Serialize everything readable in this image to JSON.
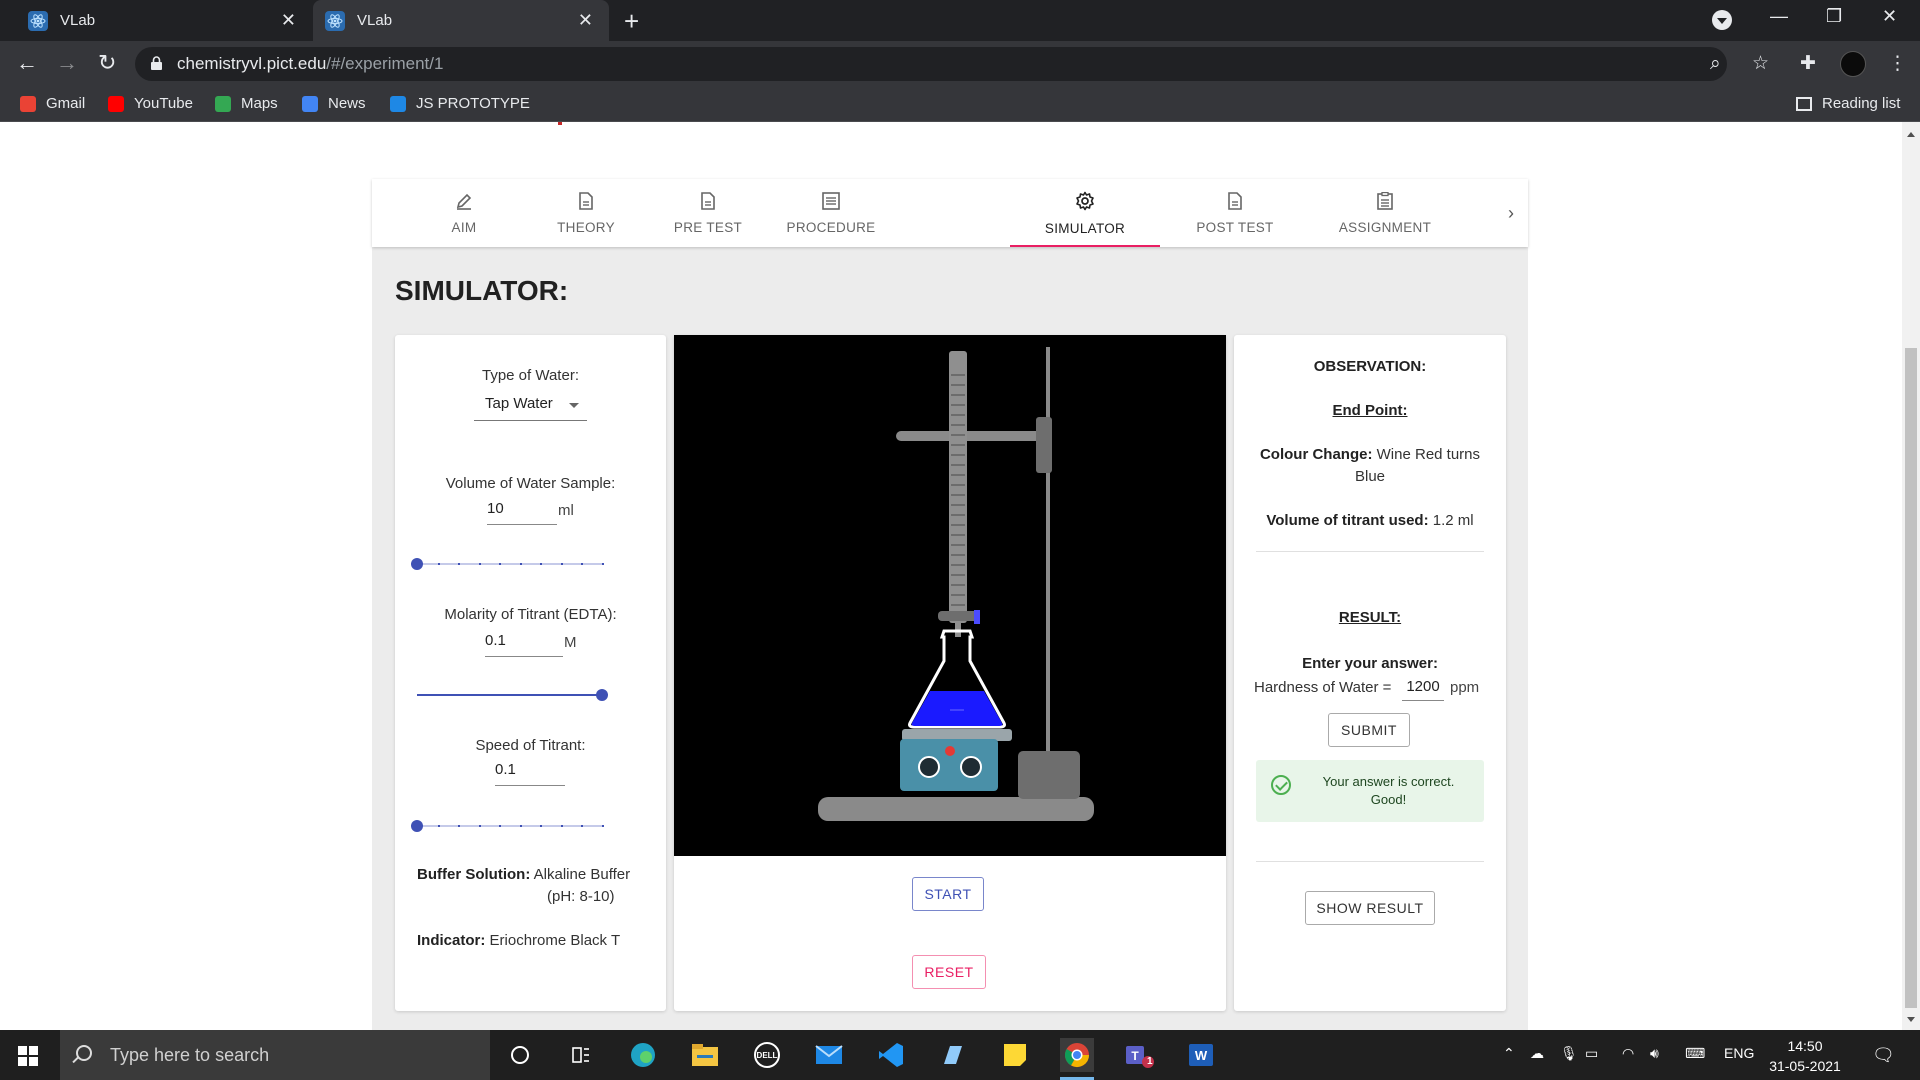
{
  "browser": {
    "tabs": [
      {
        "title": "VLab",
        "active": false
      },
      {
        "title": "VLab",
        "active": true
      }
    ],
    "url_domain": "chemistryvl.pict.edu",
    "url_path": "/#/experiment/1",
    "bookmarks": [
      {
        "label": "Gmail",
        "icon": "gmail-icon",
        "color": "#ea4335"
      },
      {
        "label": "YouTube",
        "icon": "youtube-icon",
        "color": "#ff0000"
      },
      {
        "label": "Maps",
        "icon": "maps-icon",
        "color": "#34a853"
      },
      {
        "label": "News",
        "icon": "news-icon",
        "color": "#4285f4"
      },
      {
        "label": "JS PROTOTYPE",
        "icon": "js-prototype-icon",
        "color": "#1e88e5"
      }
    ],
    "reading_list": "Reading list"
  },
  "nav_tabs": [
    {
      "label": "AIM",
      "icon": "pencil-icon"
    },
    {
      "label": "THEORY",
      "icon": "document-icon"
    },
    {
      "label": "PRE TEST",
      "icon": "document-icon"
    },
    {
      "label": "PROCEDURE",
      "icon": "list-icon"
    },
    {
      "label": "SIMULATOR",
      "icon": "gear-icon",
      "active": true
    },
    {
      "label": "POST TEST",
      "icon": "document-icon"
    },
    {
      "label": "ASSIGNMENT",
      "icon": "clipboard-icon"
    }
  ],
  "page_title": "SIMULATOR:",
  "controls": {
    "water_type_label": "Type of Water:",
    "water_type_value": "Tap Water",
    "volume_label": "Volume of Water Sample:",
    "volume_value": "10",
    "volume_unit": "ml",
    "volume_slider_fraction": 0.0,
    "molarity_label": "Molarity of Titrant (EDTA):",
    "molarity_value": "0.1",
    "molarity_unit": "M",
    "molarity_slider_fraction": 1.0,
    "speed_label": "Speed of Titrant:",
    "speed_value": "0.1",
    "speed_slider_fraction": 0.0,
    "buffer_label": "Buffer Solution:",
    "buffer_value": "Alkaline Buffer",
    "buffer_ph": "(pH: 8-10)",
    "indicator_label": "Indicator:",
    "indicator_value": "Eriochrome Black T"
  },
  "simulator": {
    "solution_color": "#1a1aff",
    "start_label": "START",
    "reset_label": "RESET"
  },
  "observation": {
    "heading": "OBSERVATION:",
    "end_point_heading": "End Point:",
    "colour_change_label": "Colour Change:",
    "colour_change_value": "Wine Red turns",
    "colour_change_value2": "Blue",
    "volume_used_label": "Volume of titrant used:",
    "volume_used_value": "1.2 ml",
    "result_heading": "RESULT:",
    "answer_prompt": "Enter your answer:",
    "hardness_label": "Hardness of Water =",
    "hardness_value": "1200",
    "hardness_unit": "ppm",
    "submit_label": "SUBMIT",
    "success_line1": "Your answer is correct.",
    "success_line2": "Good!",
    "show_result_label": "SHOW RESULT"
  },
  "taskbar": {
    "search_placeholder": "Type here to search",
    "language": "ENG",
    "time": "14:50",
    "date": "31-05-2021",
    "teams_badge": "1"
  }
}
